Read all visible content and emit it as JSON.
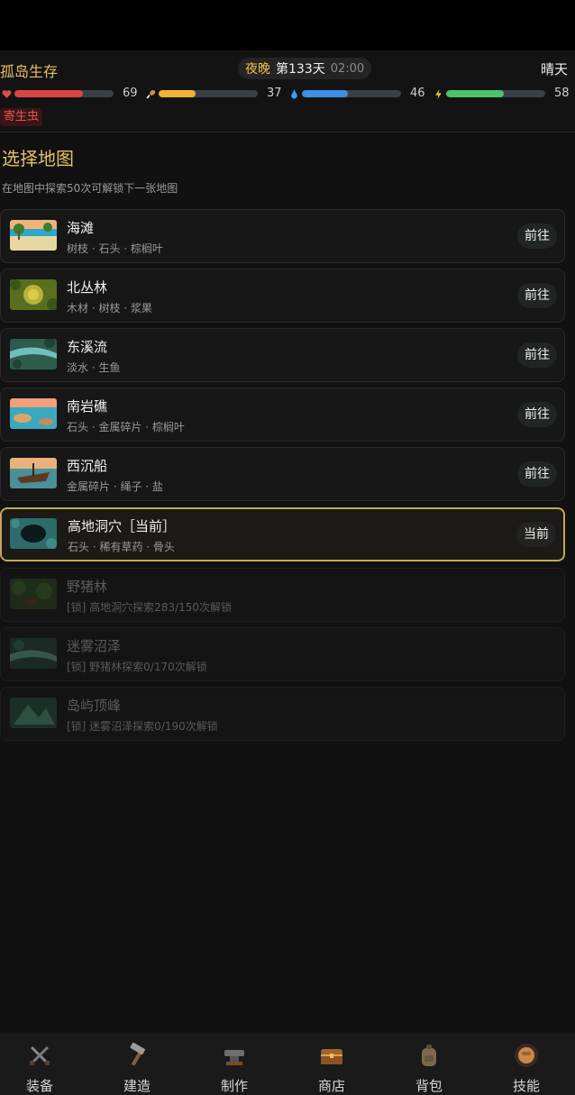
{
  "header": {
    "app_title": "孤岛生存",
    "time_phase": "夜晚",
    "day": "第133天",
    "clock": "02:00",
    "weather": "晴天",
    "stats": [
      {
        "icon": "heart-icon",
        "value": "69",
        "fraction": 0.69,
        "color": "#d94444"
      },
      {
        "icon": "drumstick-icon",
        "value": "37",
        "fraction": 0.37,
        "color": "#f0b233"
      },
      {
        "icon": "water-drop-icon",
        "value": "46",
        "fraction": 0.46,
        "color": "#3d8ee6"
      },
      {
        "icon": "lightning-icon",
        "value": "58",
        "fraction": 0.58,
        "color": "#4cc26a"
      }
    ],
    "status_badge": "寄生虫"
  },
  "map": {
    "title": "选择地图",
    "subtitle": "在地图中探索50次可解锁下一张地图",
    "items": [
      {
        "name": "海滩",
        "resources": "树枝 · 石头 · 棕榈叶",
        "action": "前往"
      },
      {
        "name": "北丛林",
        "resources": "木材 · 树枝 · 浆果",
        "action": "前往"
      },
      {
        "name": "东溪流",
        "resources": "淡水 · 生鱼",
        "action": "前往"
      },
      {
        "name": "南岩礁",
        "resources": "石头 · 金属碎片 · 棕榈叶",
        "action": "前往"
      },
      {
        "name": "西沉船",
        "resources": "金属碎片 · 绳子 · 盐",
        "action": "前往"
      },
      {
        "name": "高地洞穴［当前］",
        "resources": "石头 · 稀有草药 · 骨头",
        "action": "当前"
      },
      {
        "name": "野猪林",
        "resources": "[锁] 高地洞穴探索283/150次解锁"
      },
      {
        "name": "迷雾沼泽",
        "resources": "[锁] 野猪林探索0/170次解锁"
      },
      {
        "name": "岛屿顶峰",
        "resources": "[锁] 迷雾沼泽探索0/190次解锁"
      }
    ]
  },
  "nav": {
    "items": [
      {
        "label": "装备",
        "icon": "crossed-swords-icon"
      },
      {
        "label": "建造",
        "icon": "hammer-icon"
      },
      {
        "label": "制作",
        "icon": "anvil-icon"
      },
      {
        "label": "商店",
        "icon": "treasure-chest-icon"
      },
      {
        "label": "背包",
        "icon": "backpack-icon"
      },
      {
        "label": "技能",
        "icon": "fist-icon"
      }
    ]
  },
  "colors": {
    "accent_gold": "#e6c066",
    "current_border": "#c4a55b",
    "badge_red": "#e05454"
  }
}
